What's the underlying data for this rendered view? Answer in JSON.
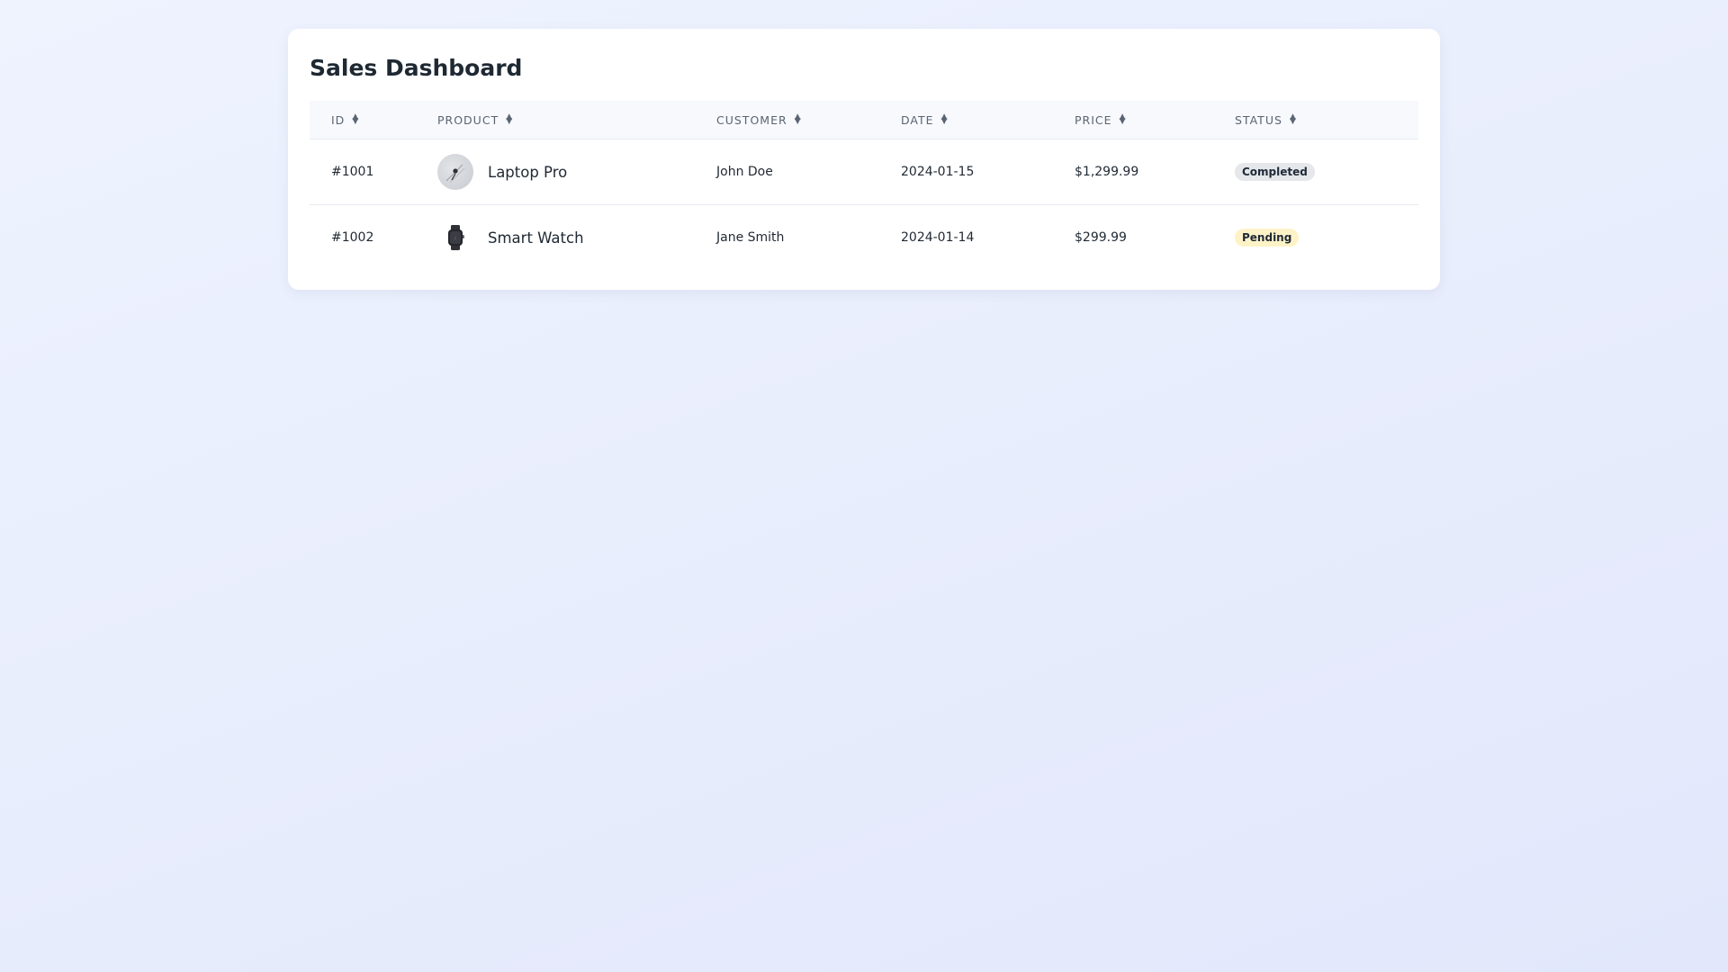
{
  "page": {
    "title": "Sales Dashboard"
  },
  "table": {
    "headers": {
      "id": "ID",
      "product": "PRODUCT",
      "customer": "CUSTOMER",
      "date": "DATE",
      "price": "PRICE",
      "status": "STATUS"
    },
    "sort_icon": "sort-updown-icon",
    "rows": [
      {
        "id": "#1001",
        "product": "Laptop Pro",
        "product_icon": "laptop-thumbnail",
        "customer": "John Doe",
        "date": "2024-01-15",
        "price": "$1,299.99",
        "status": "Completed"
      },
      {
        "id": "#1002",
        "product": "Smart Watch",
        "product_icon": "smartwatch-thumbnail",
        "customer": "Jane Smith",
        "date": "2024-01-14",
        "price": "$299.99",
        "status": "Pending"
      }
    ]
  },
  "colors": {
    "status_completed_bg": "#e5e7eb",
    "status_pending_bg": "#fef3c7",
    "header_bg": "#f7f9fc"
  }
}
